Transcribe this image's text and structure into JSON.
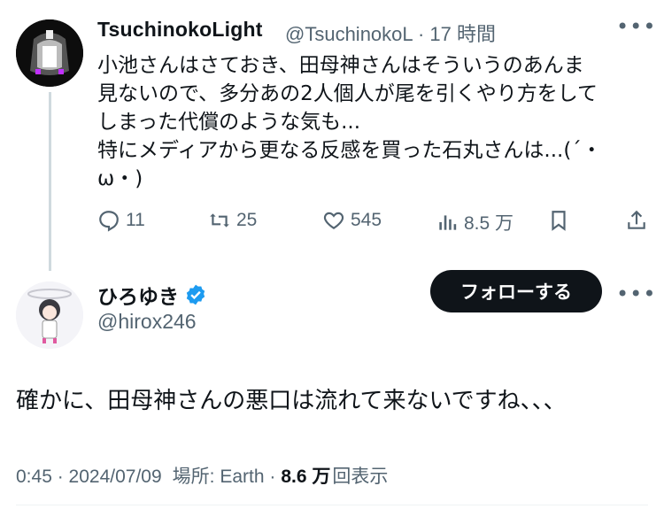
{
  "reply_tweet": {
    "display_name": "TsuchinokoLight",
    "handle": "@TsuchinokoL",
    "time_ago": "17 時間",
    "text": "小池さんはさておき、田母神さんはそういうのあんま\n見ないので、多分あの2人個人が尾を引くやり方をして\nしまった代償のような気も...\n特にメディアから更なる反感を買った石丸さんは...(´・\nω・)",
    "replies": "11",
    "reposts": "25",
    "likes": "545",
    "views": "8.5 万",
    "more": "•••"
  },
  "main_tweet": {
    "display_name": "ひろゆき",
    "handle": "@hirox246",
    "follow_label": "フォローする",
    "text": "確かに、田母神さんの悪口は流れて来ないですね、、、",
    "time": "0:45",
    "date": "2024/07/09",
    "location": "場所: Earth",
    "views_count": "8.6 万",
    "views_label": "回表示",
    "more": "•••"
  },
  "colors": {
    "verified": "#1d9bf0",
    "secondary_text": "#536471",
    "follow_bg": "#0f1419"
  },
  "icons": [
    "reply-icon",
    "repost-icon",
    "like-icon",
    "views-icon",
    "bookmark-icon",
    "share-icon",
    "verified-icon",
    "more-icon"
  ]
}
